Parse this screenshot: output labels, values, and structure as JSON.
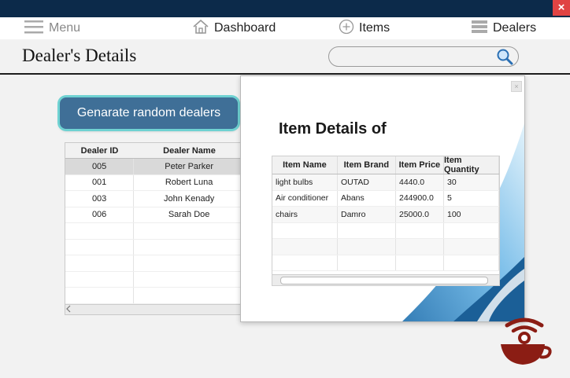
{
  "window": {
    "close_glyph": "×"
  },
  "nav": {
    "menu": {
      "label": "Menu",
      "icon": "hamburger-icon"
    },
    "dashboard": {
      "label": "Dashboard",
      "icon": "home-icon"
    },
    "items": {
      "label": "Items",
      "icon": "plus-circle-icon"
    },
    "dealers": {
      "label": "Dealers",
      "icon": "stack-icon"
    }
  },
  "page": {
    "title": "Dealer's Details"
  },
  "search": {
    "placeholder": "",
    "icon": "search-icon"
  },
  "generate_button": {
    "label": "Genarate random dealers"
  },
  "dealer_table": {
    "columns": [
      "Dealer ID",
      "Dealer Name"
    ],
    "rows": [
      [
        "005",
        "Peter Parker"
      ],
      [
        "001",
        "Robert Luna"
      ],
      [
        "003",
        "John Kenady"
      ],
      [
        "006",
        "Sarah Doe"
      ]
    ]
  },
  "item_dialog": {
    "title": "Item Details of",
    "columns": [
      "Item Name",
      "Item Brand",
      "Item Price",
      "Item Quantity"
    ],
    "rows": [
      [
        "light bulbs",
        "OUTAD",
        "4440.0",
        "30"
      ],
      [
        "Air conditioner",
        "Abans",
        "244900.0",
        "5"
      ],
      [
        "chairs",
        "Damro",
        "25000.0",
        "100"
      ]
    ]
  },
  "colors": {
    "titlebar": "#0c2a4a",
    "accent_button": "#3f6f97",
    "button_glow": "#6fd2d2",
    "logo": "#8b1d14"
  }
}
